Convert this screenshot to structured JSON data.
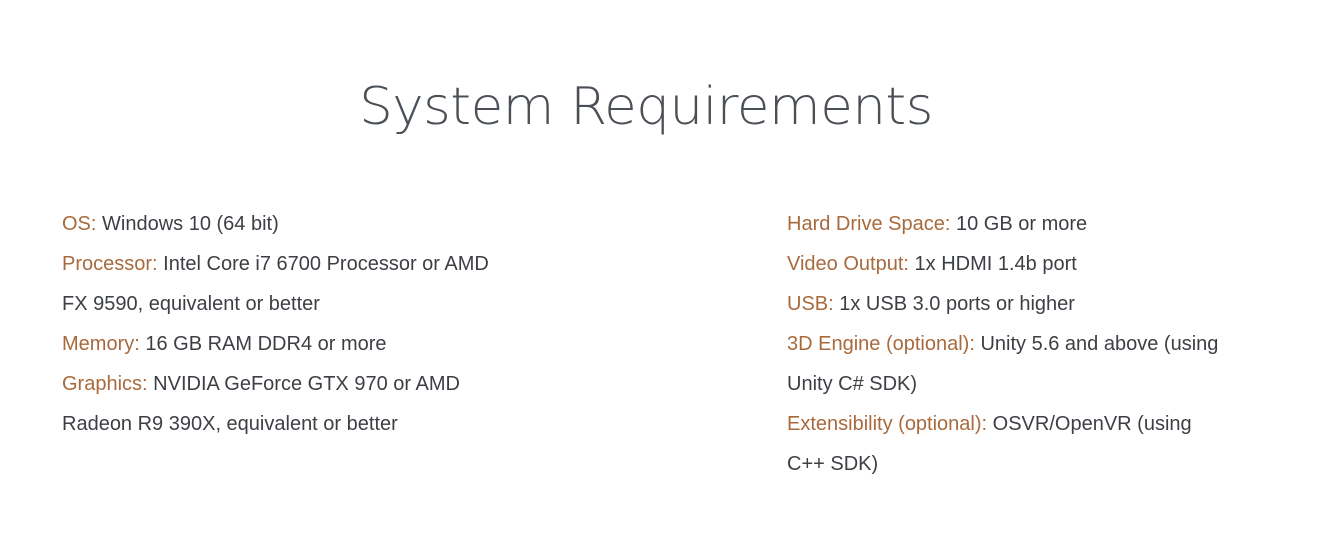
{
  "page": {
    "title": "System Requirements"
  },
  "requirements": {
    "left": [
      {
        "label": "OS:",
        "value": "Windows 10 (64 bit)"
      },
      {
        "label": "Processor:",
        "value": "Intel Core i7 6700 Processor or AMD FX 9590, equivalent or better"
      },
      {
        "label": "Memory:",
        "value": "16 GB RAM DDR4 or more"
      },
      {
        "label": "Graphics:",
        "value": "NVIDIA GeForce GTX 970 or AMD Radeon R9 390X, equivalent or better"
      }
    ],
    "right": [
      {
        "label": "Hard Drive Space:",
        "value": "10 GB or more"
      },
      {
        "label": "Video Output:",
        "value": "1x HDMI 1.4b port"
      },
      {
        "label": "USB:",
        "value": "1x USB 3.0 ports or higher"
      },
      {
        "label": "3D Engine (optional):",
        "value": "Unity 5.6 and above (using Unity C# SDK)"
      },
      {
        "label": "Extensibility (optional):",
        "value": "OSVR/OpenVR (using C++ SDK)"
      }
    ]
  },
  "colors": {
    "label": "#a86a3d",
    "text": "#3c3f44",
    "title": "#4b5057",
    "background": "#ffffff"
  }
}
